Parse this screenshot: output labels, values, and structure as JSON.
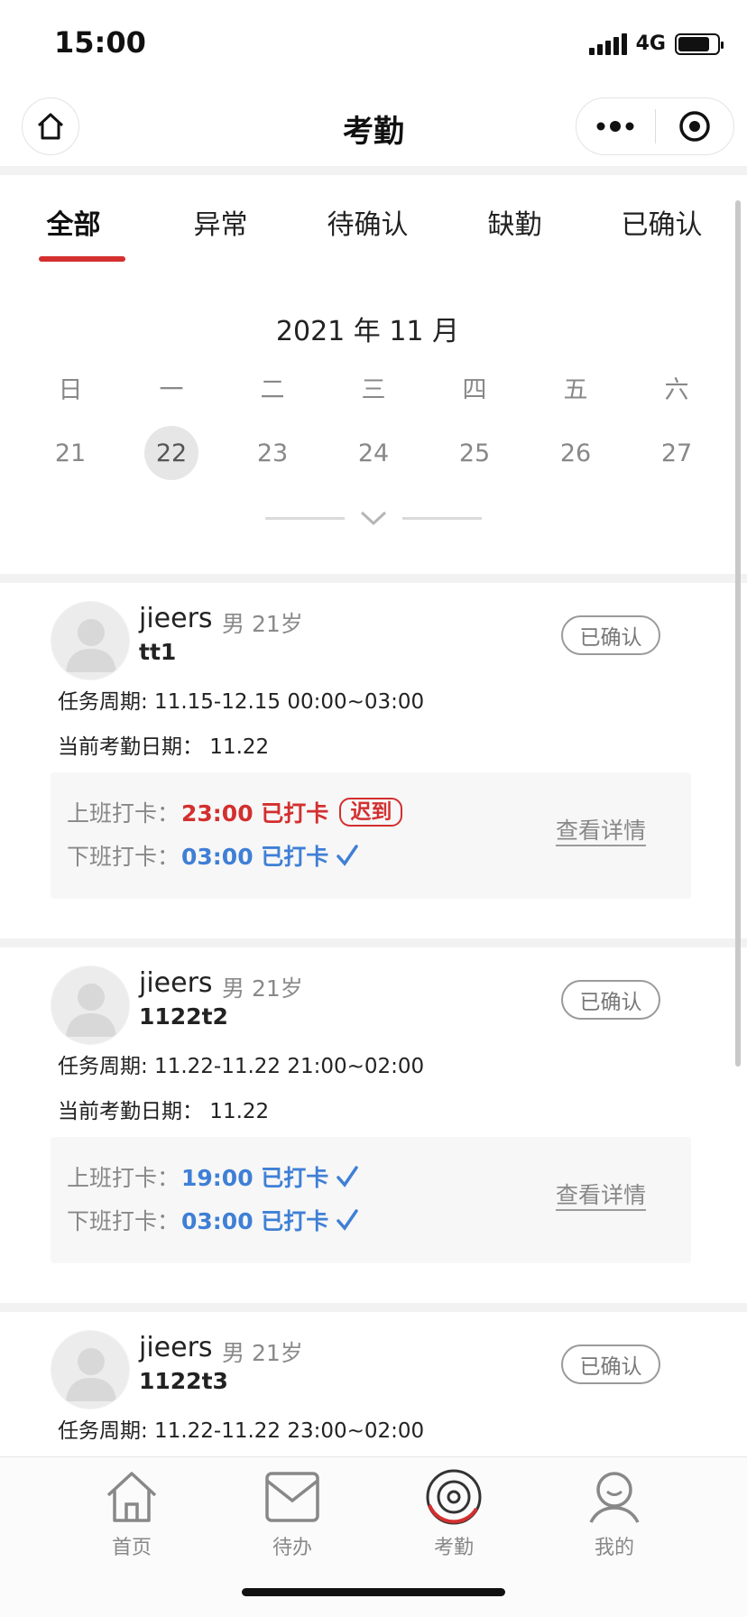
{
  "status_bar": {
    "time": "15:00",
    "network": "4G"
  },
  "nav": {
    "title": "考勤"
  },
  "tabs": [
    {
      "label": "全部",
      "active": true
    },
    {
      "label": "异常",
      "active": false
    },
    {
      "label": "待确认",
      "active": false
    },
    {
      "label": "缺勤",
      "active": false
    },
    {
      "label": "已确认",
      "active": false
    }
  ],
  "calendar": {
    "month_label": "2021 年 11 月",
    "weekdays": [
      "日",
      "一",
      "二",
      "三",
      "四",
      "五",
      "六"
    ],
    "dates": [
      "21",
      "22",
      "23",
      "24",
      "25",
      "26",
      "27"
    ],
    "selected_date": "22"
  },
  "records": [
    {
      "name": "jieers",
      "meta": "男 21岁",
      "task": "tt1",
      "status": "已确认",
      "period": "任务周期: 11.15-12.15 00:00~03:00",
      "current_date": "当前考勤日期：  11.22",
      "clock_in_label": "上班打卡：",
      "clock_in_value": "23:00 已打卡",
      "clock_in_state": "late",
      "clock_in_tag": "迟到",
      "clock_out_label": "下班打卡：",
      "clock_out_value": "03:00 已打卡",
      "clock_out_state": "ok",
      "detail_label": "查看详情"
    },
    {
      "name": "jieers",
      "meta": "男 21岁",
      "task": "1122t2",
      "status": "已确认",
      "period": "任务周期: 11.22-11.22 21:00~02:00",
      "current_date": "当前考勤日期：  11.22",
      "clock_in_label": "上班打卡：",
      "clock_in_value": "19:00 已打卡",
      "clock_in_state": "ok",
      "clock_out_label": "下班打卡：",
      "clock_out_value": "03:00 已打卡",
      "clock_out_state": "ok",
      "detail_label": "查看详情"
    },
    {
      "name": "jieers",
      "meta": "男 21岁",
      "task": "1122t3",
      "status": "已确认",
      "period": "任务周期: 11.22-11.22 23:00~02:00"
    }
  ],
  "tab_bar": [
    {
      "label": "首页",
      "icon": "home-icon"
    },
    {
      "label": "待办",
      "icon": "mail-icon"
    },
    {
      "label": "考勤",
      "icon": "attendance-icon"
    },
    {
      "label": "我的",
      "icon": "user-icon"
    }
  ],
  "colors": {
    "accent": "#d32f2f",
    "ok": "#3f7fd6",
    "muted": "#888888"
  }
}
